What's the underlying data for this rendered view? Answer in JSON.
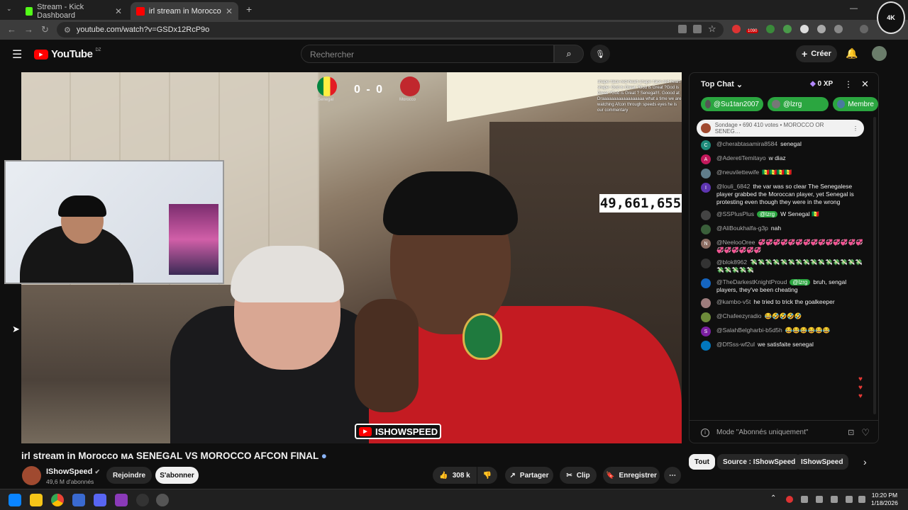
{
  "browser": {
    "tabs": [
      {
        "title": "Stream - Kick Dashboard"
      },
      {
        "title": "irl stream in Morocco ᴍᴀ S"
      }
    ],
    "url": "youtube.com/watch?v=GSDx12RcP9o",
    "ext_counts": [
      "1090"
    ]
  },
  "yt": {
    "logo_text": "YouTube",
    "country": "DZ",
    "search_placeholder": "Rechercher",
    "create_label": "Créer"
  },
  "video": {
    "score": "0 - 0",
    "team_left": "Senegal",
    "team_right": "Morocco",
    "viewer_count": "49,661,655",
    "overlay_logo": "ISHOWSPEED",
    "minichat": "shape::face-red-heart-shape::face-red-heart-shape: God is Great ?God is Great ?God is Great ?God is Great ? Senegal!!!. Goood at Draaaaaaaaaaaaaaaaaa what a time we are watching Afcon through speeds eyes he is our commentary"
  },
  "meta": {
    "title": "irl stream in Morocco ᴍᴀ SENEGAL VS MOROCCO AFCON FINAL",
    "channel": "IShowSpeed",
    "subscribers": "49,6 M d'abonnés",
    "join_label": "Rejoindre",
    "subscribe_label": "S'abonner",
    "likes": "308 k",
    "share_label": "Partager",
    "clip_label": "Clip",
    "save_label": "Enregistrer"
  },
  "chat": {
    "header": "Top Chat",
    "xp": "0 XP",
    "pinned": [
      {
        "name": "@Su1tan2007",
        "color": "#2ba640"
      },
      {
        "name": "@lzrg",
        "color": "#2ba640"
      },
      {
        "name": "Membre",
        "color": "#2ba640"
      }
    ],
    "poll": "Sondage • 690 410 votes • MOROCCO OR SENEG…",
    "messages": [
      {
        "author": "@cherabtasamira8584",
        "text": "senegal",
        "initial": "C",
        "color": "#1e8a7a"
      },
      {
        "author": "@AderetiTemitayo",
        "text": "w diaz",
        "initial": "A",
        "color": "#c2185b"
      },
      {
        "author": "@neuvilettewife",
        "text": "🇸🇳🇸🇳🇸🇳🇸🇳",
        "initial": "",
        "color": "#607d8b"
      },
      {
        "author": "@louli_6842",
        "text": "the var was so clear The Senegalese player grabbed the Moroccan player, yet Senegal is protesting even though they were in the wrong",
        "initial": "I",
        "color": "#5e35b1"
      },
      {
        "author": "@SSPlusPlus",
        "badge": "@lzrg",
        "text": "W Senegal 🇸🇳",
        "initial": "",
        "color": "#444"
      },
      {
        "author": "@AliBoukhalfa-g3p",
        "text": "nah",
        "initial": "",
        "color": "#3a5f3a"
      },
      {
        "author": "@NeelooOree",
        "text": "💞💞💞💞💞💞💞💞💞💞💞💞💞💞💞💞💞💞💞💞",
        "initial": "N",
        "color": "#8d6e63"
      },
      {
        "author": "@blok8962",
        "text": "💸💸💸💸💸💸💸💸💸💸💸💸💸💸💸💸💸💸💸💸",
        "initial": "",
        "color": "#333"
      },
      {
        "author": "@TheDarkestKnightProud",
        "badge": "@lzrg",
        "text": "bruh, sengal players, they've been cheating",
        "initial": "",
        "color": "#1565c0"
      },
      {
        "author": "@kambo-v5t",
        "text": "he tried to trick the goalkeeper",
        "initial": "",
        "color": "#9e7d7d"
      },
      {
        "author": "@Chafeezyradio",
        "text": "😂🤣🤣🤣🤣",
        "initial": "",
        "color": "#6d8b3a"
      },
      {
        "author": "@SalahBelgharbi-b5d5h",
        "text": "😂😂😂😂😂😂",
        "initial": "S",
        "color": "#7b1fa2"
      },
      {
        "author": "@DfSss-wf2ul",
        "text": "we satisfaite senegal",
        "initial": "",
        "color": "#0277bd"
      }
    ],
    "input_placeholder": "Mode \"Abonnés uniquement\""
  },
  "filters": [
    "Tout",
    "Source : IShowSpeed",
    "IShowSpeed"
  ],
  "taskbar": {
    "time": "10:20 PM",
    "date": "1/18/2026"
  },
  "colors": {
    "yt_red": "#ff0000",
    "chat_green": "#2ba640",
    "bg": "#0f0f0f"
  }
}
